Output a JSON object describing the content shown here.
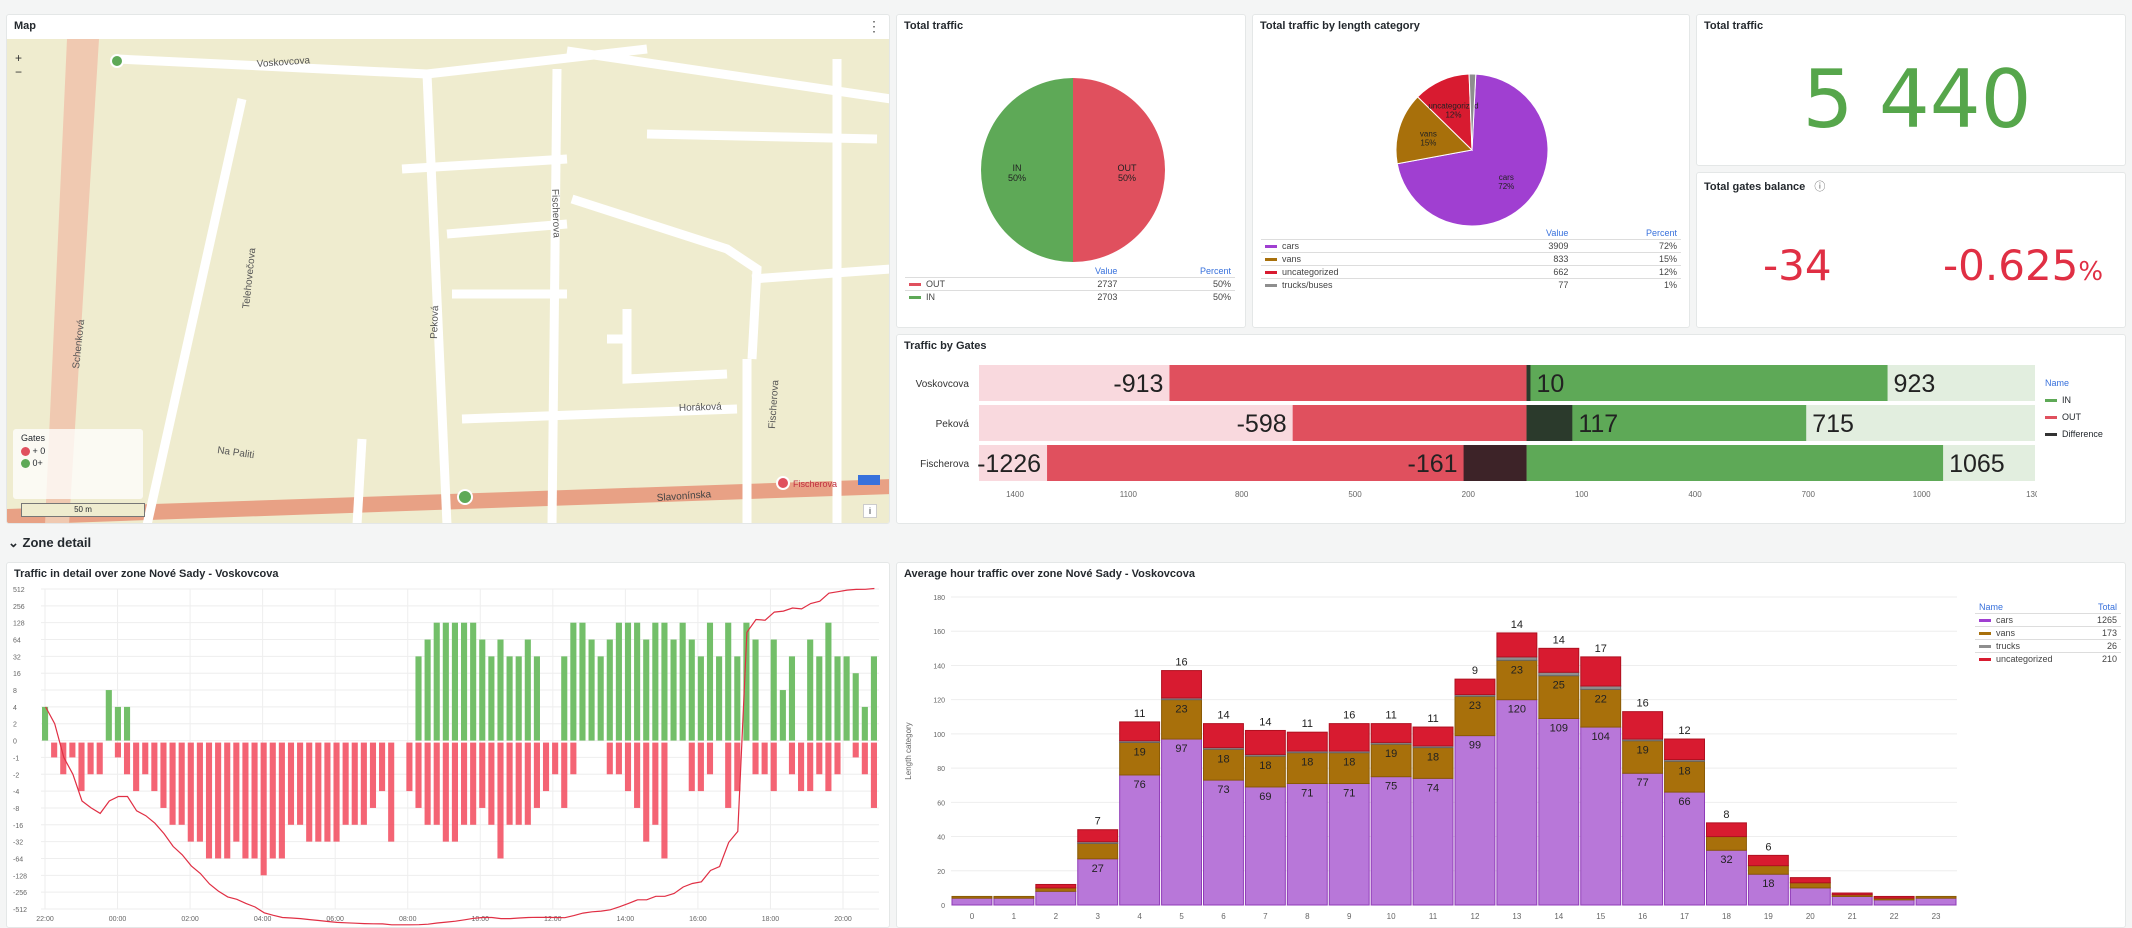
{
  "map_panel": {
    "title": "Map",
    "zoom_in": "+",
    "zoom_out": "−",
    "streets": [
      "Voskovcova",
      "Schenková",
      "Telehovečova",
      "Peková",
      "Fischerova",
      "Fischerova",
      "Horáková",
      "Na Paliti",
      "Slavonínska"
    ],
    "legend_title": "Gates",
    "legend_items": [
      "+ 0",
      "0+"
    ],
    "scale_label": "50 m",
    "marker_label": "Fischerova",
    "info": "i"
  },
  "total_traffic_pie": {
    "title": "Total traffic",
    "legend_headers": [
      "Value",
      "Percent"
    ],
    "slices": [
      {
        "name": "OUT",
        "value": 2737,
        "percent": "50%",
        "color": "#e0505e"
      },
      {
        "name": "IN",
        "value": 2703,
        "percent": "50%",
        "color": "#5ea957"
      }
    ],
    "slice_labels": [
      "IN\n50%",
      "OUT\n50%"
    ]
  },
  "length_pie": {
    "title": "Total traffic by length category",
    "legend_headers": [
      "Value",
      "Percent"
    ],
    "slices": [
      {
        "name": "cars",
        "value": 3909,
        "percent": "72%",
        "color": "#a03fd1"
      },
      {
        "name": "vans",
        "value": 833,
        "percent": "15%",
        "color": "#a8700b"
      },
      {
        "name": "uncategorized",
        "value": 662,
        "percent": "12%",
        "color": "#d81b30"
      },
      {
        "name": "trucks/buses",
        "value": 77,
        "percent": "1%",
        "color": "#8e8e8e"
      }
    ]
  },
  "total_traffic_stat": {
    "title": "Total traffic",
    "value": "5 440",
    "color": "#56a64b"
  },
  "gates_balance": {
    "title": "Total gates balance",
    "info_icon": "ⓘ",
    "value": "-34",
    "percent_value": "-0.625",
    "percent_unit": "%",
    "color": "#e02f44"
  },
  "traffic_by_gates": {
    "title": "Traffic by Gates",
    "legend_title": "Name",
    "legend": [
      {
        "name": "IN",
        "color": "#5ea957"
      },
      {
        "name": "OUT",
        "color": "#e0505e"
      },
      {
        "name": "Difference",
        "color": "#333333"
      }
    ],
    "x_ticks": [
      "1400",
      "1100",
      "800",
      "500",
      "200",
      "100",
      "400",
      "700",
      "1000",
      "1300"
    ]
  },
  "row_header": "Zone detail",
  "detail_panel": {
    "title": "Traffic in detail over zone Nové Sady - Voskovcova",
    "y_ticks": [
      "512",
      "256",
      "128",
      "64",
      "32",
      "16",
      "8",
      "4",
      "2",
      "0",
      "-1",
      "-2",
      "-4",
      "-8",
      "-16",
      "-32",
      "-64",
      "-128",
      "-256",
      "-512"
    ],
    "x_ticks": [
      "22:00",
      "00:00",
      "02:00",
      "04:00",
      "06:00",
      "08:00",
      "10:00",
      "12:00",
      "14:00",
      "16:00",
      "18:00",
      "20:00"
    ]
  },
  "hourly_panel": {
    "title": "Average hour traffic over zone Nové Sady - Voskovcova",
    "y_axis_label": "Length category",
    "y_ticks": [
      "180",
      "160",
      "140",
      "120",
      "100",
      "80",
      "60",
      "40",
      "20",
      "0"
    ],
    "legend_headers": [
      "Name",
      "Total"
    ],
    "legend": [
      {
        "name": "cars",
        "total": "1265",
        "color": "#a03fd1"
      },
      {
        "name": "vans",
        "total": "173",
        "color": "#a8700b"
      },
      {
        "name": "trucks",
        "total": "26",
        "color": "#8e8e8e"
      },
      {
        "name": "uncategorized",
        "total": "210",
        "color": "#d81b30"
      }
    ]
  },
  "chart_data": [
    {
      "type": "bar",
      "title": "Traffic by Gates",
      "orientation": "horizontal",
      "categories": [
        "Voskovcova",
        "Peková",
        "Fischerova"
      ],
      "series": [
        {
          "name": "IN",
          "values": [
            923,
            715,
            1065
          ]
        },
        {
          "name": "OUT",
          "values": [
            -913,
            -598,
            -1226
          ]
        },
        {
          "name": "Difference",
          "values": [
            10,
            117,
            -161
          ]
        }
      ],
      "xlim": [
        -1400,
        1300
      ]
    },
    {
      "type": "bar",
      "title": "Average hour traffic over zone Nové Sady - Voskovcova",
      "ylabel": "Length category",
      "stacked": true,
      "categories": [
        "0",
        "1",
        "2",
        "3",
        "4",
        "5",
        "6",
        "7",
        "8",
        "9",
        "10",
        "11",
        "12",
        "13",
        "14",
        "15",
        "16",
        "17",
        "18",
        "19",
        "20",
        "21",
        "22",
        "23"
      ],
      "series": [
        {
          "name": "cars",
          "values": [
            4,
            4,
            8,
            27,
            76,
            97,
            73,
            69,
            71,
            71,
            75,
            74,
            99,
            120,
            109,
            104,
            77,
            66,
            32,
            18,
            10,
            5,
            3,
            4
          ]
        },
        {
          "name": "vans",
          "values": [
            1,
            1,
            2,
            9,
            19,
            23,
            18,
            18,
            18,
            18,
            19,
            18,
            23,
            23,
            25,
            22,
            19,
            18,
            8,
            5,
            3,
            1,
            1,
            1
          ]
        },
        {
          "name": "trucks",
          "values": [
            0,
            0,
            0,
            1,
            1,
            1,
            1,
            1,
            1,
            1,
            1,
            1,
            1,
            2,
            2,
            2,
            1,
            1,
            0,
            0,
            0,
            0,
            0,
            0
          ]
        },
        {
          "name": "uncategorized",
          "values": [
            0,
            0,
            2,
            7,
            11,
            16,
            14,
            14,
            11,
            16,
            11,
            11,
            9,
            14,
            14,
            17,
            16,
            12,
            8,
            6,
            3,
            1,
            1,
            0
          ]
        }
      ],
      "labels": {
        "cars": [
          null,
          null,
          null,
          27,
          76,
          97,
          73,
          69,
          71,
          71,
          75,
          74,
          99,
          120,
          109,
          104,
          77,
          66,
          32,
          18,
          null,
          null,
          null,
          null
        ],
        "vans": [
          null,
          null,
          null,
          null,
          19,
          23,
          18,
          18,
          18,
          18,
          19,
          18,
          23,
          23,
          25,
          22,
          19,
          18,
          null,
          null,
          null,
          null,
          null,
          null
        ],
        "uncategorized": [
          null,
          null,
          null,
          7,
          11,
          16,
          14,
          14,
          11,
          16,
          11,
          11,
          9,
          14,
          14,
          17,
          16,
          12,
          8,
          6,
          null,
          null,
          null,
          null
        ]
      },
      "ylim": [
        0,
        180
      ]
    },
    {
      "type": "bar",
      "title": "Traffic in detail over zone Nové Sady - Voskovcova",
      "yscale": "symlog",
      "series": [
        {
          "name": "IN",
          "values": [
            2,
            0,
            0,
            0,
            0,
            0,
            0,
            4,
            2,
            2,
            0,
            0,
            0,
            0,
            0,
            0,
            0,
            0,
            0,
            0,
            0,
            0,
            0,
            0,
            0,
            0,
            0,
            0,
            0,
            0,
            0,
            0,
            0,
            0,
            0,
            0,
            0,
            0,
            0,
            0,
            0,
            16,
            32,
            64,
            64,
            64,
            64,
            64,
            32,
            16,
            32,
            16,
            16,
            32,
            16,
            0,
            0,
            16,
            64,
            64,
            32,
            16,
            32,
            64,
            64,
            64,
            32,
            64,
            64,
            32,
            64,
            32,
            16,
            64,
            16,
            64,
            16,
            64,
            32,
            0,
            32,
            4,
            16,
            0,
            32,
            16,
            64,
            16,
            16,
            8,
            2,
            16
          ]
        },
        {
          "name": "OUT",
          "values": [
            0,
            -1,
            -2,
            -1,
            -4,
            -2,
            -2,
            0,
            -1,
            -2,
            -4,
            -2,
            -4,
            -8,
            -16,
            -16,
            -32,
            -32,
            -64,
            -64,
            -64,
            -32,
            -64,
            -64,
            -128,
            -64,
            -64,
            -16,
            -16,
            -32,
            -32,
            -32,
            -32,
            -16,
            -16,
            -16,
            -8,
            -4,
            -32,
            0,
            -4,
            -8,
            -16,
            -16,
            -32,
            -32,
            -16,
            -16,
            -8,
            -16,
            -64,
            -16,
            -16,
            -16,
            -8,
            -4,
            -2,
            -8,
            -2,
            0,
            0,
            0,
            -2,
            -2,
            -4,
            -8,
            -32,
            -16,
            -64,
            0,
            0,
            -4,
            -4,
            -2,
            0,
            -8,
            -4,
            0,
            -2,
            -2,
            -4,
            0,
            -2,
            -4,
            -4,
            -2,
            -4,
            -2,
            0,
            -1,
            -2,
            -8
          ]
        },
        {
          "name": "Balance",
          "values": [
            2,
            1,
            -1,
            -2,
            -6,
            -8,
            -10,
            -6,
            -5,
            -5,
            -9,
            -11,
            -15,
            -23,
            -39,
            -55,
            -87,
            -119,
            -183,
            -247,
            -311,
            -343,
            -407,
            -471,
            -599,
            -663,
            -727,
            -743,
            -759,
            -791,
            -823,
            -855,
            -887,
            -903,
            -919,
            -935,
            -943,
            -947,
            -979,
            -979,
            -983,
            -975,
            -959,
            -911,
            -879,
            -847,
            -799,
            -751,
            -727,
            -727,
            -759,
            -759,
            -743,
            -727,
            -719,
            -723,
            -725,
            -733,
            -671,
            -607,
            -575,
            -559,
            -529,
            -467,
            -407,
            -351,
            -351,
            -303,
            -303,
            -271,
            -207,
            -179,
            -167,
            -105,
            -89,
            -33,
            -21,
            43,
            73,
            71,
            99,
            103,
            117,
            113,
            141,
            155,
            215,
            229,
            245,
            252,
            253,
            261
          ]
        }
      ]
    }
  ]
}
